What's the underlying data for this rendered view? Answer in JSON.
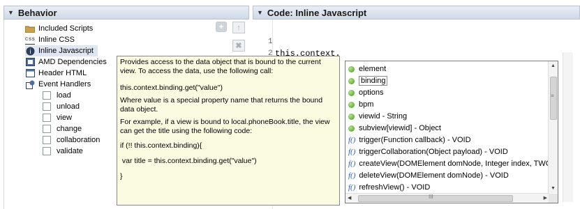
{
  "behavior": {
    "title": "Behavior",
    "items": [
      {
        "label": "Included Scripts",
        "icon": "folder-icon"
      },
      {
        "label": "Inline CSS",
        "icon": "css-icon"
      },
      {
        "label": "Inline Javascript",
        "icon": "javascript-icon"
      },
      {
        "label": "AMD Dependencies",
        "icon": "amd-icon"
      },
      {
        "label": "Header HTML",
        "icon": "html-icon"
      },
      {
        "label": "Event Handlers",
        "icon": "event-handlers-icon"
      }
    ],
    "events": [
      "load",
      "unload",
      "view",
      "change",
      "collaboration",
      "validate"
    ],
    "add_symbol": "+",
    "up_symbol": "↑",
    "remove_symbol": "✖"
  },
  "code": {
    "title": "Code: Inline Javascript",
    "lines": [
      {
        "number": "1",
        "text": ""
      },
      {
        "number": "2",
        "text": "this.context."
      }
    ]
  },
  "tooltip": {
    "paragraphs": [
      "Provides access to the data object that is bound to the current view. To access the data, use the following call:",
      "this.context.binding.get(\"value\")",
      "Where value is a special property name that returns the bound data object.",
      "For example, if a view is bound to local.phoneBook.title, the view can get the title using the following code:",
      "if (!! this.context.binding){",
      " var title = this.context.binding.get(\"value\")",
      "}"
    ]
  },
  "autocomplete": {
    "items": [
      {
        "kind": "property",
        "label": "element"
      },
      {
        "kind": "property",
        "label": "binding",
        "selected": true
      },
      {
        "kind": "property",
        "label": "options"
      },
      {
        "kind": "property",
        "label": "bpm"
      },
      {
        "kind": "property",
        "label": "viewid - String"
      },
      {
        "kind": "property",
        "label": "subview[viewid] - Object"
      },
      {
        "kind": "function",
        "label": "trigger(Function callback) - VOID"
      },
      {
        "kind": "function",
        "label": "triggerCollaboration(Object payload) - VOID"
      },
      {
        "kind": "function",
        "label": "createView(DOMElement domNode, Integer index, TWCo"
      },
      {
        "kind": "function",
        "label": "deleteView(DOMElement domNode) - VOID"
      },
      {
        "kind": "function",
        "label": "refreshView() - VOID"
      }
    ],
    "fn_prefix": "f()",
    "scroll_grip": "≡",
    "hscroll_grip": "III"
  }
}
